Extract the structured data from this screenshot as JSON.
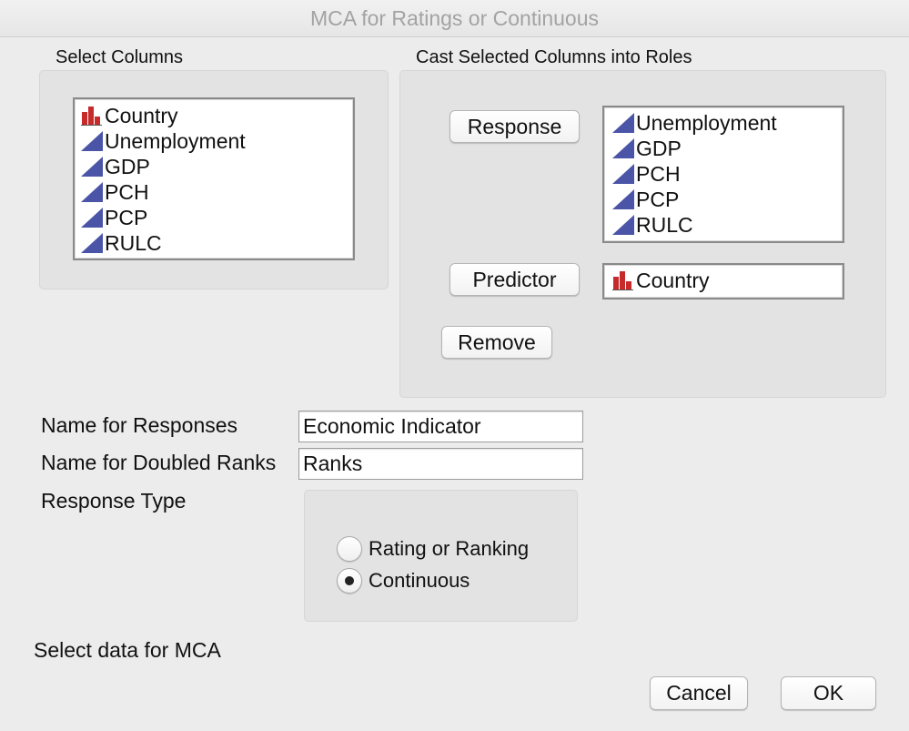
{
  "window": {
    "title": "MCA for Ratings or Continuous"
  },
  "select_columns": {
    "label": "Select Columns",
    "items": [
      {
        "label": "Country",
        "type": "nominal"
      },
      {
        "label": "Unemployment",
        "type": "continuous"
      },
      {
        "label": "GDP",
        "type": "continuous"
      },
      {
        "label": "PCH",
        "type": "continuous"
      },
      {
        "label": "PCP",
        "type": "continuous"
      },
      {
        "label": "RULC",
        "type": "continuous"
      }
    ]
  },
  "cast_roles": {
    "label": "Cast Selected Columns into Roles",
    "response_button": "Response",
    "response_items": [
      {
        "label": "Unemployment",
        "type": "continuous"
      },
      {
        "label": "GDP",
        "type": "continuous"
      },
      {
        "label": "PCH",
        "type": "continuous"
      },
      {
        "label": "PCP",
        "type": "continuous"
      },
      {
        "label": "RULC",
        "type": "continuous"
      }
    ],
    "predictor_button": "Predictor",
    "predictor_items": [
      {
        "label": "Country",
        "type": "nominal"
      }
    ],
    "remove_button": "Remove"
  },
  "form": {
    "responses_label": "Name for Responses",
    "responses_value": "Economic Indicator",
    "ranks_label": "Name for Doubled Ranks",
    "ranks_value": "Ranks",
    "response_type_label": "Response Type",
    "response_type_options": [
      {
        "label": "Rating or Ranking",
        "selected": false
      },
      {
        "label": "Continuous",
        "selected": true
      }
    ]
  },
  "status": {
    "text": "Select data for MCA"
  },
  "buttons": {
    "cancel": "Cancel",
    "ok": "OK"
  },
  "colors": {
    "continuous_icon": "#4a55a8",
    "nominal_icon": "#c62a2a",
    "window_bg": "#ececec",
    "group_bg": "#e3e3e3"
  }
}
